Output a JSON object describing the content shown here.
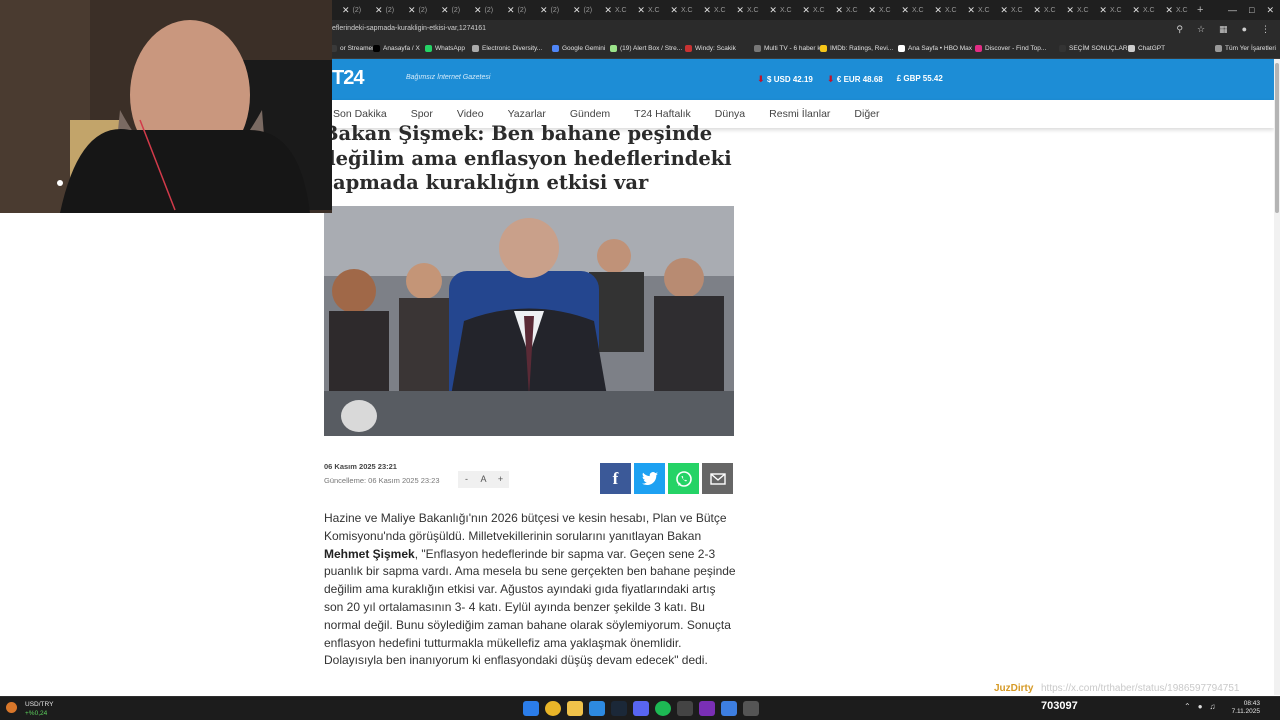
{
  "browser": {
    "tabs": [
      "(2)",
      "(2)",
      "(2)",
      "(2)",
      "(2)",
      "(2)",
      "(2)",
      "(2)",
      "X.C",
      "X.C",
      "X.C",
      "X.C",
      "X.C",
      "X.C",
      "X.C",
      "X.C",
      "X.C",
      "X.C",
      "X.C",
      "X.C",
      "X.C",
      "X.C",
      "X.C",
      "X.C",
      "X.C",
      "X.C"
    ],
    "url": "eflerindeki-sapmada-kurakligin-etkisi-var,1274161",
    "bookmarks": [
      {
        "label": "or Streamers",
        "color": "#3a3a3a"
      },
      {
        "label": "Anasayfa / X",
        "color": "#000000"
      },
      {
        "label": "WhatsApp",
        "color": "#25d366"
      },
      {
        "label": "Electronic Diversity...",
        "color": "#aaaaaa"
      },
      {
        "label": "Google Gemini",
        "color": "#4f86f7"
      },
      {
        "label": "(19) Alert Box / Stre...",
        "color": "#9be38a"
      },
      {
        "label": "Windy: Scakik",
        "color": "#c83232"
      },
      {
        "label": "Multi TV - 6 haber k...",
        "color": "#777777"
      },
      {
        "label": "IMDb: Ratings, Revi...",
        "color": "#f5c518"
      },
      {
        "label": "Ana Sayfa • HBO Max",
        "color": "#ffffff"
      },
      {
        "label": "Discover - Find Top...",
        "color": "#e22c84"
      },
      {
        "label": "SEÇİM SONUÇLARI...",
        "color": "#333333"
      },
      {
        "label": "ChatGPT",
        "color": "#cccccc"
      },
      {
        "label": "Tüm Yer İşaretleri",
        "color": "#999999"
      }
    ]
  },
  "site": {
    "logo": "T24",
    "tagline": "Bağımsız İnternet Gazetesi",
    "rates": [
      {
        "label": "$ USD 42.19",
        "down": true
      },
      {
        "label": "€ EUR 48.68",
        "down": true
      },
      {
        "label": "£ GBP 55.42",
        "down": false
      }
    ],
    "nav": [
      "Son Dakika",
      "Spor",
      "Video",
      "Yazarlar",
      "Gündem",
      "T24 Haftalık",
      "Dünya",
      "Resmi İlanlar",
      "Diğer"
    ]
  },
  "article": {
    "headline": "Bakan Şişmek: Ben bahane peşinde değilim ama enflasyon hedeflerindeki sapmada kuraklığın etkisi var",
    "date": "06 Kasım 2025 23:21",
    "updated": "Güncelleme: 06 Kasım 2025 23:23",
    "font_minus": "-",
    "font_a": "A",
    "font_plus": "+",
    "body_p1": "Hazine ve Maliye Bakanlığı'nın 2026 bütçesi ve kesin hesabı, Plan ve Bütçe Komisyonu'nda görüşüldü. Milletvekillerinin sorularını yanıtlayan Bakan ",
    "body_name": "Mehmet Şişmek",
    "body_p2": ", \"Enflasyon hedeflerinde bir sapma var. Geçen sene 2-3 puanlık bir sapma vardı. Ama mesela bu sene gerçekten ben bahane peşinde değilim ama kuraklığın etkisi var. Ağustos ayındaki gıda fiyatlarındaki artış son 20 yıl ortalamasının 3- 4 katı. Eylül ayında benzer şekilde 3 katı. Bu normal değil. Bunu söylediğim zaman bahane olarak söylemiyorum. Sonuçta enflasyon hedefini tutturmakla mükellefiz ama yaklaşmak önemlidir. Dolayısıyla ben inanıyorum ki enflasyondaki düşüş devam edecek\" dedi."
  },
  "overlay": {
    "brand": "JuzDirty",
    "link": "https://x.com/trthaber/status/1986597794751"
  },
  "taskbar": {
    "ticker_name": "USD/TRY",
    "ticker_change": "+%0,24",
    "counter": "703097",
    "time": "08:43",
    "date": "7.11.2025"
  },
  "colors": {
    "t24_blue": "#1d8dd6",
    "facebook": "#3b5998",
    "twitter": "#1da1f2",
    "whatsapp": "#25d366",
    "email": "#666666"
  }
}
